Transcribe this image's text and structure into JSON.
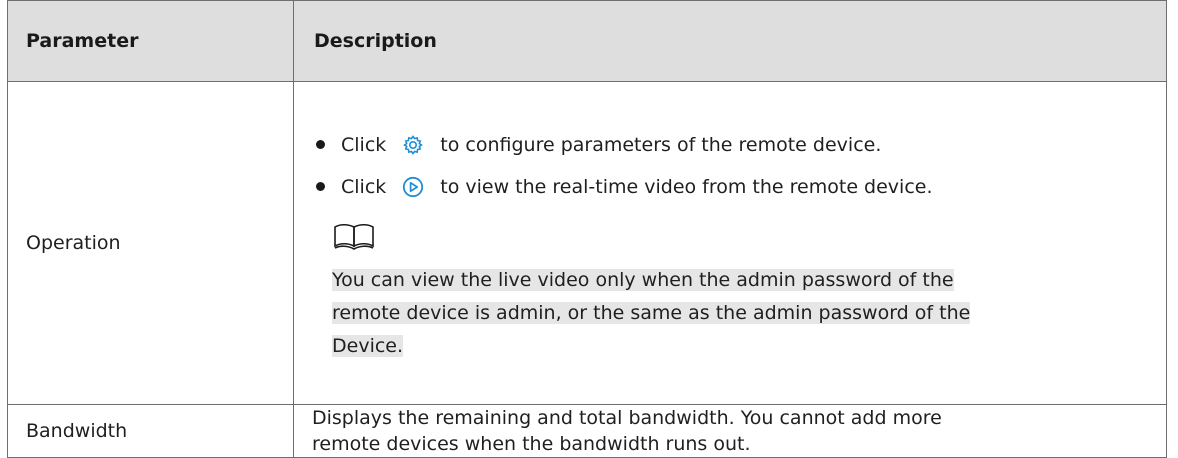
{
  "table": {
    "header": {
      "parameter": "Parameter",
      "description": "Description"
    },
    "rows": [
      {
        "parameter": "Operation",
        "bullets": [
          {
            "prefix": "Click",
            "icon": "gear-icon",
            "suffix": "to configure parameters of the remote device."
          },
          {
            "prefix": "Click",
            "icon": "play-icon",
            "suffix": "to view the real-time video from the remote device."
          }
        ],
        "note_icon": "book-icon",
        "note_lines": [
          "You can view the live video only when the admin password of the",
          "remote device is admin, or the same as the admin password of the",
          "Device."
        ]
      },
      {
        "parameter": "Bandwidth",
        "description_lines": [
          "Displays the remaining and total bandwidth. You cannot add more",
          "remote devices when the bandwidth runs out."
        ]
      }
    ]
  },
  "colors": {
    "header_bg": "#dedede",
    "border": "#6e6e6e",
    "icon_accent": "#1e8fd6",
    "note_highlight": "#e6e6e6"
  }
}
